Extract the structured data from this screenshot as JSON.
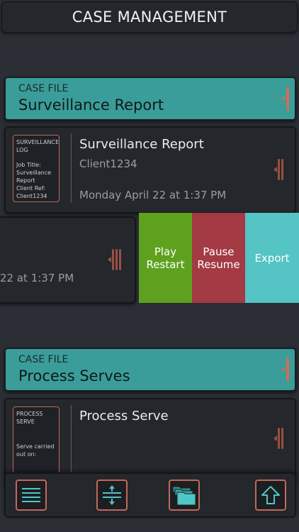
{
  "header": {
    "title": "CASE MANAGEMENT"
  },
  "case_files": [
    {
      "kicker": "CASE FILE",
      "name": "Surveillance Report",
      "card": {
        "thumb_heading": "SURVEILLANCE LOG",
        "thumb_lines": [
          "Job Title:",
          "Surveillance Report",
          "Client Ref:",
          "Client1234"
        ],
        "title": "Surveillance Report",
        "client": "Client1234",
        "date": "Monday April 22 at 1:37 PM"
      }
    },
    {
      "kicker": "CASE FILE",
      "name": "Process Serves",
      "card": {
        "thumb_heading": "PROCESS SERVE",
        "thumb_lines": [
          "Serve carried",
          "out on:"
        ],
        "title": "Process Serve"
      }
    }
  ],
  "swiped_row": {
    "date_fragment": "22 at 1:37 PM",
    "actions": [
      {
        "line1": "Play",
        "line2": "Restart",
        "color": "#5ea11e"
      },
      {
        "line1": "Pause",
        "line2": "Resume",
        "color": "#a33a44"
      },
      {
        "line1": "Export",
        "line2": "",
        "color": "#55c4c4"
      }
    ]
  },
  "toolbar": {
    "buttons": [
      {
        "icon": "menu-icon"
      },
      {
        "icon": "expand-collapse-icon"
      },
      {
        "icon": "folders-icon"
      },
      {
        "icon": "upload-icon"
      }
    ],
    "accent": "#c0695a",
    "icon_color": "#4fc6c6"
  }
}
